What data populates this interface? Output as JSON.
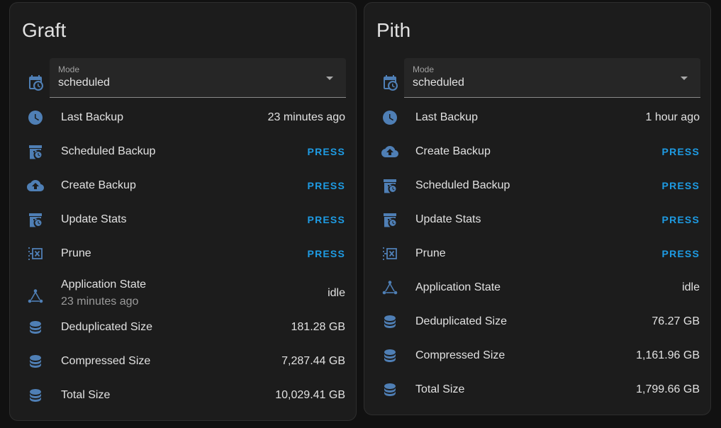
{
  "colors": {
    "accent": "#1e9be3",
    "icon": "#4f7fb5",
    "card": "#1c1c1c",
    "background": "#111111"
  },
  "cards": [
    {
      "title": "Graft",
      "mode": {
        "label": "Mode",
        "value": "scheduled",
        "icon": "calendar-clock-icon"
      },
      "rows": [
        {
          "label": "Last Backup",
          "value": "23 minutes ago",
          "icon": "clock-icon"
        },
        {
          "label": "Scheduled Backup",
          "button": "PRESS",
          "icon": "archive-clock-icon"
        },
        {
          "label": "Create Backup",
          "button": "PRESS",
          "icon": "cloud-upload-icon"
        },
        {
          "label": "Update Stats",
          "button": "PRESS",
          "icon": "archive-clock-icon"
        },
        {
          "label": "Prune",
          "button": "PRESS",
          "icon": "table-column-remove-icon"
        },
        {
          "label": "Application State",
          "secondary": "23 minutes ago",
          "value": "idle",
          "icon": "state-machine-icon"
        },
        {
          "label": "Deduplicated Size",
          "value": "181.28 GB",
          "icon": "database-icon"
        },
        {
          "label": "Compressed Size",
          "value": "7,287.44 GB",
          "icon": "database-icon"
        },
        {
          "label": "Total Size",
          "value": "10,029.41 GB",
          "icon": "database-icon"
        }
      ]
    },
    {
      "title": "Pith",
      "mode": {
        "label": "Mode",
        "value": "scheduled",
        "icon": "calendar-clock-icon"
      },
      "rows": [
        {
          "label": "Last Backup",
          "value": "1 hour ago",
          "icon": "clock-icon"
        },
        {
          "label": "Create Backup",
          "button": "PRESS",
          "icon": "cloud-upload-icon"
        },
        {
          "label": "Scheduled Backup",
          "button": "PRESS",
          "icon": "archive-clock-icon"
        },
        {
          "label": "Update Stats",
          "button": "PRESS",
          "icon": "archive-clock-icon"
        },
        {
          "label": "Prune",
          "button": "PRESS",
          "icon": "table-column-remove-icon"
        },
        {
          "label": "Application State",
          "value": "idle",
          "icon": "state-machine-icon"
        },
        {
          "label": "Deduplicated Size",
          "value": "76.27 GB",
          "icon": "database-icon"
        },
        {
          "label": "Compressed Size",
          "value": "1,161.96 GB",
          "icon": "database-icon"
        },
        {
          "label": "Total Size",
          "value": "1,799.66 GB",
          "icon": "database-icon"
        }
      ]
    }
  ]
}
